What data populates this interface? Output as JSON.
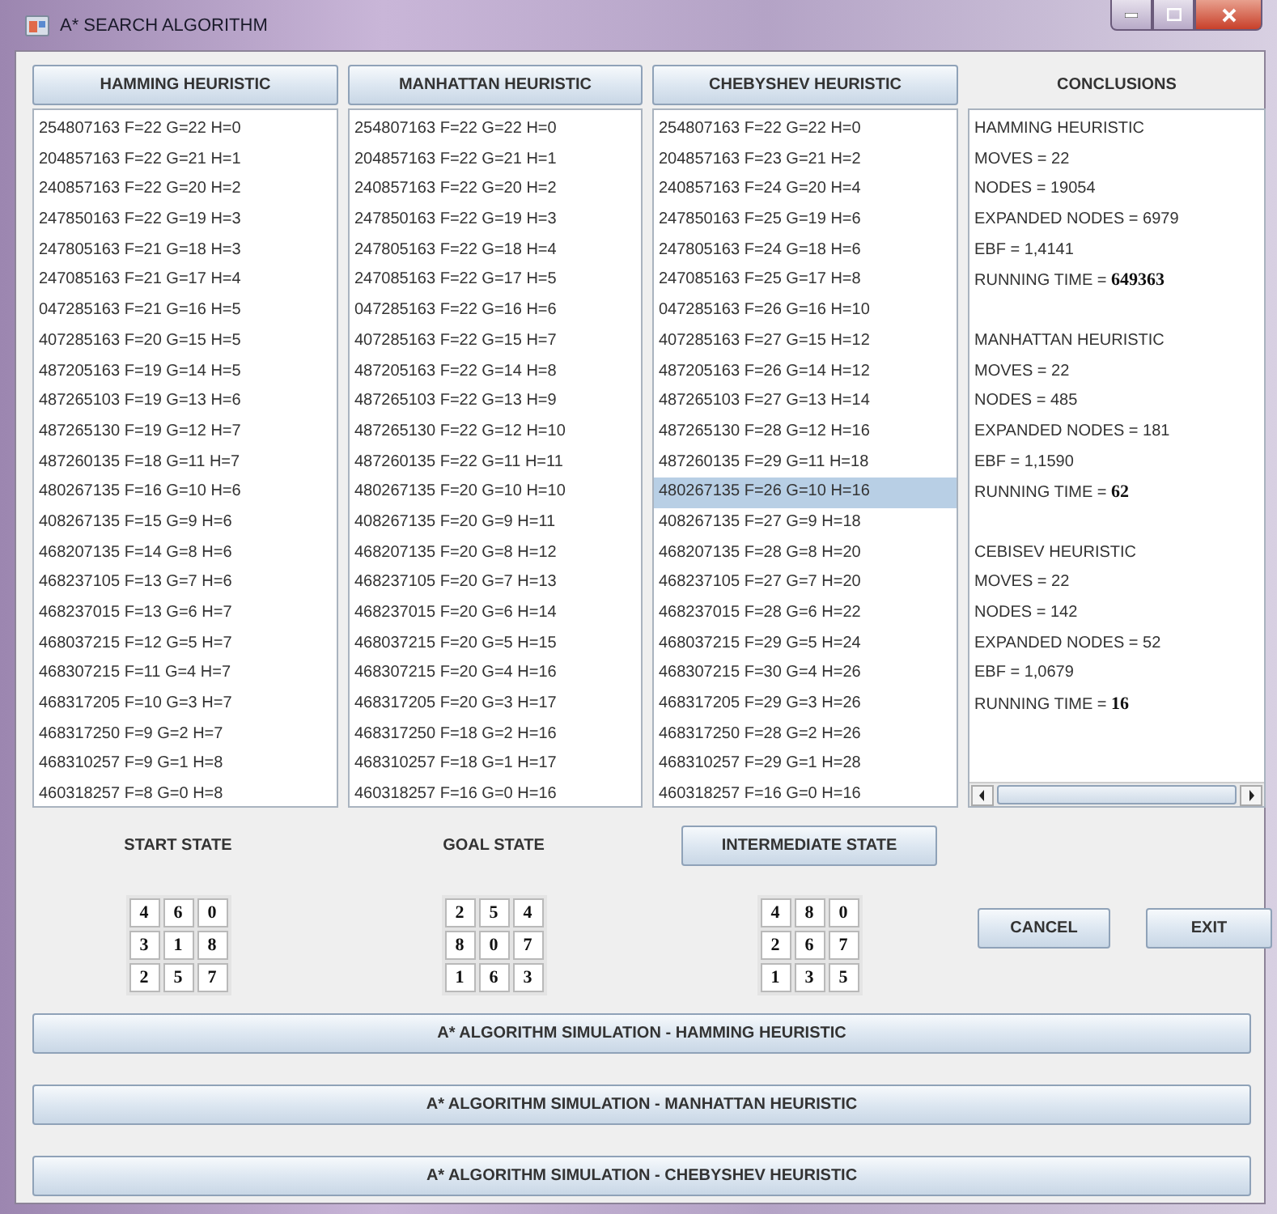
{
  "window": {
    "title": "A* SEARCH ALGORITHM"
  },
  "lists": [
    {
      "header": "HAMMING HEURISTIC",
      "rows": [
        {
          "text": "254807163 F=22 G=22 H=0",
          "selected": false
        },
        {
          "text": "204857163 F=22 G=21 H=1",
          "selected": false
        },
        {
          "text": "240857163 F=22 G=20 H=2",
          "selected": false
        },
        {
          "text": "247850163 F=22 G=19 H=3",
          "selected": false
        },
        {
          "text": "247805163 F=21 G=18 H=3",
          "selected": false
        },
        {
          "text": "247085163 F=21 G=17 H=4",
          "selected": false
        },
        {
          "text": "047285163 F=21 G=16 H=5",
          "selected": false
        },
        {
          "text": "407285163 F=20 G=15 H=5",
          "selected": false
        },
        {
          "text": "487205163 F=19 G=14 H=5",
          "selected": false
        },
        {
          "text": "487265103 F=19 G=13 H=6",
          "selected": false
        },
        {
          "text": "487265130 F=19 G=12 H=7",
          "selected": false
        },
        {
          "text": "487260135 F=18 G=11 H=7",
          "selected": false
        },
        {
          "text": "480267135 F=16 G=10 H=6",
          "selected": false
        },
        {
          "text": "408267135 F=15 G=9 H=6",
          "selected": false
        },
        {
          "text": "468207135 F=14 G=8 H=6",
          "selected": false
        },
        {
          "text": "468237105 F=13 G=7 H=6",
          "selected": false
        },
        {
          "text": "468237015 F=13 G=6 H=7",
          "selected": false
        },
        {
          "text": "468037215 F=12 G=5 H=7",
          "selected": false
        },
        {
          "text": "468307215 F=11 G=4 H=7",
          "selected": false
        },
        {
          "text": "468317205 F=10 G=3 H=7",
          "selected": false
        },
        {
          "text": "468317250 F=9 G=2 H=7",
          "selected": false
        },
        {
          "text": "468310257 F=9 G=1 H=8",
          "selected": false
        },
        {
          "text": "460318257 F=8 G=0 H=8",
          "selected": false
        }
      ]
    },
    {
      "header": "MANHATTAN HEURISTIC",
      "rows": [
        {
          "text": "254807163 F=22 G=22 H=0",
          "selected": false
        },
        {
          "text": "204857163 F=22 G=21 H=1",
          "selected": false
        },
        {
          "text": "240857163 F=22 G=20 H=2",
          "selected": false
        },
        {
          "text": "247850163 F=22 G=19 H=3",
          "selected": false
        },
        {
          "text": "247805163 F=22 G=18 H=4",
          "selected": false
        },
        {
          "text": "247085163 F=22 G=17 H=5",
          "selected": false
        },
        {
          "text": "047285163 F=22 G=16 H=6",
          "selected": false
        },
        {
          "text": "407285163 F=22 G=15 H=7",
          "selected": false
        },
        {
          "text": "487205163 F=22 G=14 H=8",
          "selected": false
        },
        {
          "text": "487265103 F=22 G=13 H=9",
          "selected": false
        },
        {
          "text": "487265130 F=22 G=12 H=10",
          "selected": false
        },
        {
          "text": "487260135 F=22 G=11 H=11",
          "selected": false
        },
        {
          "text": "480267135 F=20 G=10 H=10",
          "selected": false
        },
        {
          "text": "408267135 F=20 G=9 H=11",
          "selected": false
        },
        {
          "text": "468207135 F=20 G=8 H=12",
          "selected": false
        },
        {
          "text": "468237105 F=20 G=7 H=13",
          "selected": false
        },
        {
          "text": "468237015 F=20 G=6 H=14",
          "selected": false
        },
        {
          "text": "468037215 F=20 G=5 H=15",
          "selected": false
        },
        {
          "text": "468307215 F=20 G=4 H=16",
          "selected": false
        },
        {
          "text": "468317205 F=20 G=3 H=17",
          "selected": false
        },
        {
          "text": "468317250 F=18 G=2 H=16",
          "selected": false
        },
        {
          "text": "468310257 F=18 G=1 H=17",
          "selected": false
        },
        {
          "text": "460318257 F=16 G=0 H=16",
          "selected": false
        }
      ]
    },
    {
      "header": "CHEBYSHEV HEURISTIC",
      "rows": [
        {
          "text": "254807163 F=22 G=22 H=0",
          "selected": false
        },
        {
          "text": "204857163 F=23 G=21 H=2",
          "selected": false
        },
        {
          "text": "240857163 F=24 G=20 H=4",
          "selected": false
        },
        {
          "text": "247850163 F=25 G=19 H=6",
          "selected": false
        },
        {
          "text": "247805163 F=24 G=18 H=6",
          "selected": false
        },
        {
          "text": "247085163 F=25 G=17 H=8",
          "selected": false
        },
        {
          "text": "047285163 F=26 G=16 H=10",
          "selected": false
        },
        {
          "text": "407285163 F=27 G=15 H=12",
          "selected": false
        },
        {
          "text": "487205163 F=26 G=14 H=12",
          "selected": false
        },
        {
          "text": "487265103 F=27 G=13 H=14",
          "selected": false
        },
        {
          "text": "487265130 F=28 G=12 H=16",
          "selected": false
        },
        {
          "text": "487260135 F=29 G=11 H=18",
          "selected": false
        },
        {
          "text": "480267135 F=26 G=10 H=16",
          "selected": true
        },
        {
          "text": "408267135 F=27 G=9 H=18",
          "selected": false
        },
        {
          "text": "468207135 F=28 G=8 H=20",
          "selected": false
        },
        {
          "text": "468237105 F=27 G=7 H=20",
          "selected": false
        },
        {
          "text": "468237015 F=28 G=6 H=22",
          "selected": false
        },
        {
          "text": "468037215 F=29 G=5 H=24",
          "selected": false
        },
        {
          "text": "468307215 F=30 G=4 H=26",
          "selected": false
        },
        {
          "text": "468317205 F=29 G=3 H=26",
          "selected": false
        },
        {
          "text": "468317250 F=28 G=2 H=26",
          "selected": false
        },
        {
          "text": "468310257 F=29 G=1 H=28",
          "selected": false
        },
        {
          "text": "460318257 F=16 G=0 H=16",
          "selected": false
        }
      ]
    }
  ],
  "conclusions": {
    "title": "CONCLUSIONS",
    "sections": [
      {
        "lines": [
          "HAMMING HEURISTIC",
          "MOVES = 22",
          "NODES = 19054",
          "EXPANDED NODES = 6979",
          "EBF = 1,4141",
          "RUNNING TIME  = **649363**"
        ]
      },
      {
        "lines": [
          "MANHATTAN HEURISTIC",
          "MOVES = 22",
          "NODES = 485",
          "EXPANDED NODES = 181",
          "EBF = 1,1590",
          "RUNNING TIME  = **62**"
        ]
      },
      {
        "lines": [
          "CEBISEV HEURISTIC",
          "MOVES = 22",
          "NODES = 142",
          "EXPANDED NODES = 52",
          "EBF = 1,0679",
          "RUNNING TIME = **16**"
        ]
      }
    ]
  },
  "states": [
    {
      "kind": "label",
      "title": "START STATE",
      "tiles": [
        "4",
        "6",
        "0",
        "3",
        "1",
        "8",
        "2",
        "5",
        "7"
      ]
    },
    {
      "kind": "label",
      "title": "GOAL STATE",
      "tiles": [
        "2",
        "5",
        "4",
        "8",
        "0",
        "7",
        "1",
        "6",
        "3"
      ]
    },
    {
      "kind": "button",
      "title": "INTERMEDIATE STATE",
      "tiles": [
        "4",
        "8",
        "0",
        "2",
        "6",
        "7",
        "1",
        "3",
        "5"
      ]
    }
  ],
  "buttons": [
    "CANCEL",
    "EXIT"
  ],
  "simulation_buttons": [
    "A* ALGORITHM SIMULATION - HAMMING HEURISTIC",
    "A* ALGORITHM SIMULATION - MANHATTAN HEURISTIC",
    "A* ALGORITHM SIMULATION - CHEBYSHEV HEURISTIC"
  ]
}
